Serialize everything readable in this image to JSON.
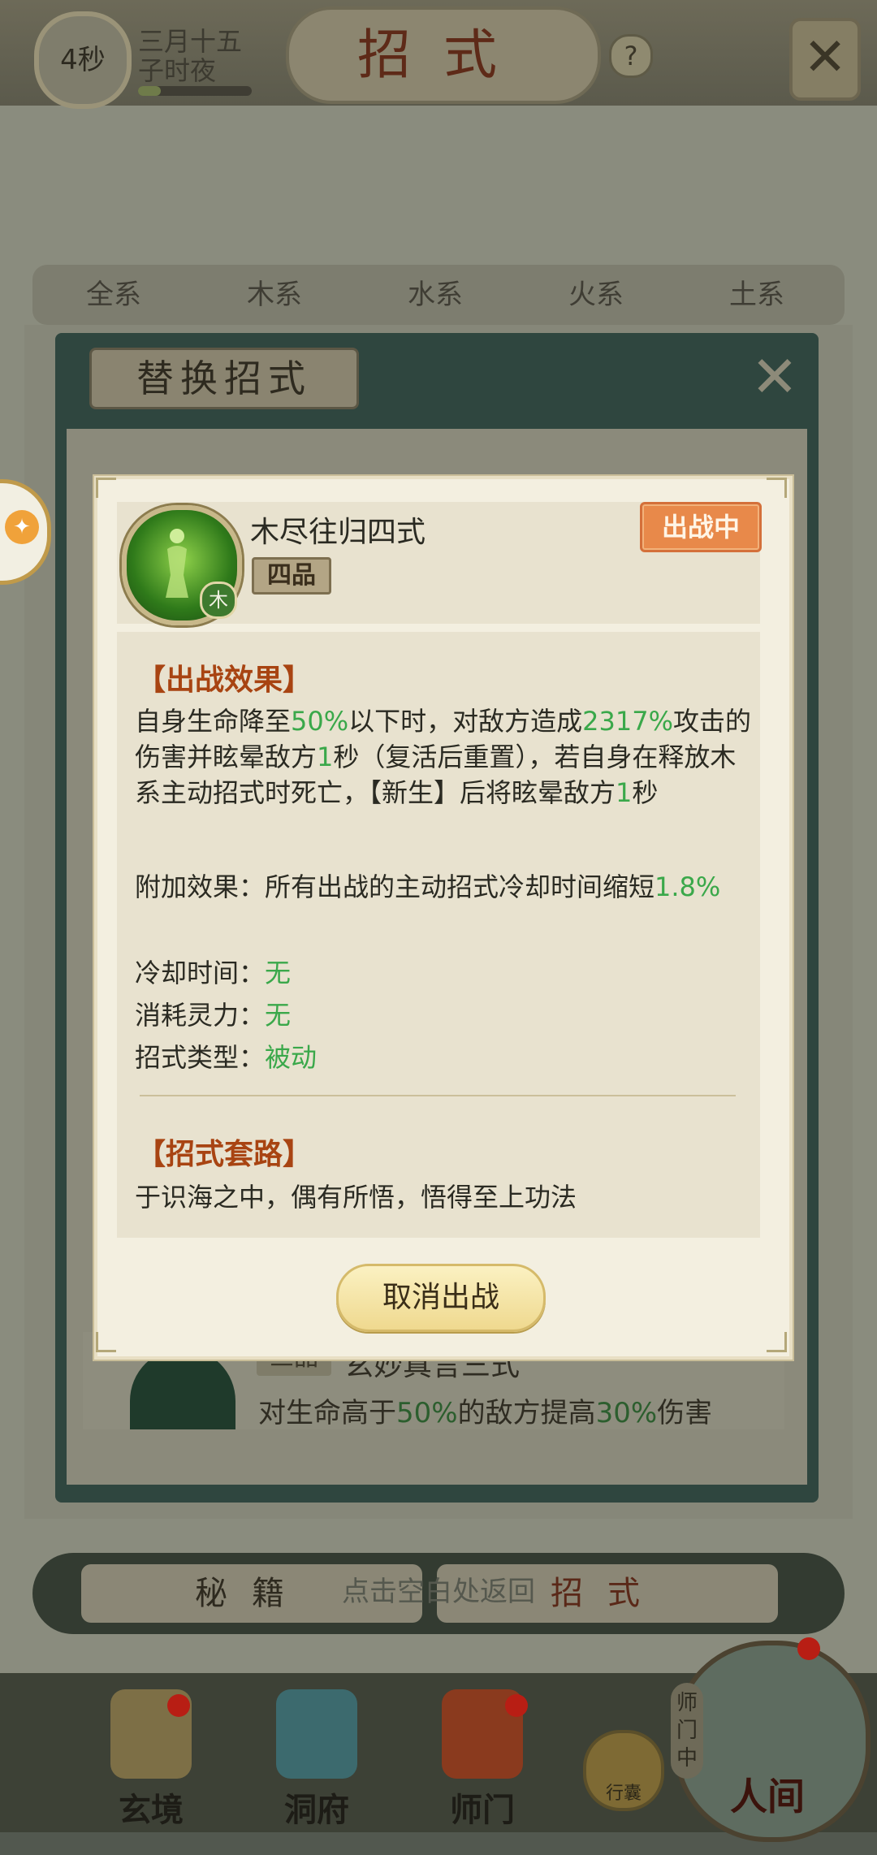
{
  "header": {
    "timer": "4秒",
    "date_line1": "三月十五",
    "date_line2": "子时夜",
    "title": "招式",
    "help": "?"
  },
  "tabs": [
    {
      "label": "全系"
    },
    {
      "label": "木系"
    },
    {
      "label": "水系"
    },
    {
      "label": "火系"
    },
    {
      "label": "土系"
    }
  ],
  "replace_panel": {
    "title": "替换招式",
    "underlying_card": {
      "grade": "三品",
      "name": "玄妙真言三式",
      "desc_prefix": "对生命高于",
      "desc_pct1": "50%",
      "desc_mid": "的敌方提高",
      "desc_pct2": "30%",
      "desc_suffix": "伤害"
    }
  },
  "detail": {
    "name": "木尽往归四式",
    "grade": "四品",
    "element": "木",
    "status": "出战中",
    "effect_title": "【出战效果】",
    "effect": {
      "t1": "自身生命降至",
      "v1": "50%",
      "t2": "以下时，对敌方造成",
      "v2": "2317%",
      "t3": "攻击的伤害并眩晕敌方",
      "v3": "1",
      "t4": "秒（复活后重置），若自身在释放木系主动招式时死亡，【新生】后将眩晕敌方",
      "v4": "1",
      "t5": "秒"
    },
    "extra_label": "附加效果：所有出战的主动招式冷却时间缩短",
    "extra_value": "1.8%",
    "cooldown_label": "冷却时间：",
    "cooldown_value": "无",
    "cost_label": "消耗灵力：",
    "cost_value": "无",
    "type_label": "招式类型：",
    "type_value": "被动",
    "lore_title": "【招式套路】",
    "lore": "于识海之中，偶有所悟，悟得至上功法",
    "cancel_button": "取消出战"
  },
  "switch": {
    "left": "秘籍",
    "right": "招式",
    "hint": "点击空白处返回"
  },
  "bottom_nav": [
    {
      "label": "玄境"
    },
    {
      "label": "洞府"
    },
    {
      "label": "师门"
    }
  ],
  "xingnang": "行囊",
  "shimen_status": "师门中",
  "renjian": "人间",
  "colors": {
    "highlight_green": "#3aa84a",
    "section_title": "#a84412",
    "status_orange": "#e8894a"
  }
}
